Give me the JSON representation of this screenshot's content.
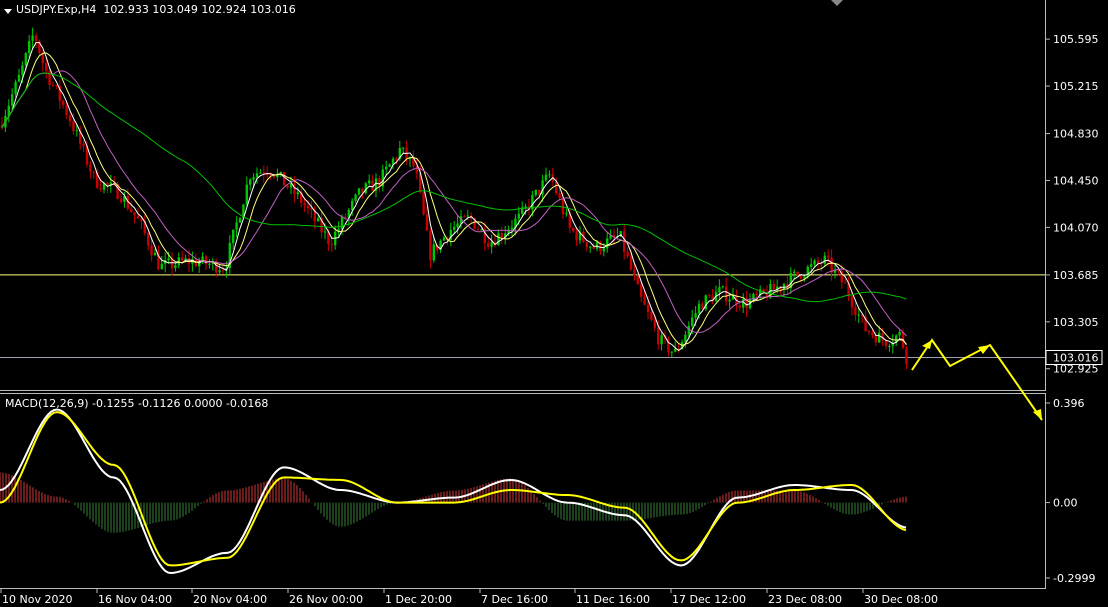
{
  "header": {
    "symbol": "USDJPY.Exp,H4",
    "ohlc": "102.933 103.049 102.924 103.016"
  },
  "macd_header": {
    "label": "MACD(12,26,9)",
    "values": "-0.1255 -0.1126 0.0000 -0.0168"
  },
  "price_axis": {
    "ticks": [
      "105.595",
      "105.215",
      "104.830",
      "104.450",
      "104.070",
      "103.685",
      "103.305",
      "102.925"
    ],
    "current_price_label": "103.016"
  },
  "macd_axis": {
    "ticks": [
      "0.396",
      "0.00",
      "-0.2999"
    ]
  },
  "time_axis": {
    "labels": [
      "10 Nov 2020",
      "16 Nov 04:00",
      "20 Nov 04:00",
      "26 Nov 00:00",
      "1 Dec 20:00",
      "7 Dec 16:00",
      "11 Dec 16:00",
      "17 Dec 12:00",
      "23 Dec 08:00",
      "30 Dec 08:00"
    ]
  },
  "colors": {
    "background": "#000000",
    "bull": "#00c800",
    "bear": "#c80000",
    "ma_fast": "#ffffff",
    "ma_mid": "#ffff80",
    "ma_slow": "#c060c0",
    "ma_long": "#00c000",
    "macd_line": "#ffffff",
    "signal_line": "#ffff00",
    "hist_pos": "#b03030",
    "hist_neg": "#2f6b2f",
    "hline": "#ffff80",
    "arrow": "#ffff00"
  },
  "chart_data": [
    {
      "type": "line",
      "title": "USDJPY.Exp,H4",
      "ylim": [
        102.85,
        105.75
      ],
      "x": [
        "10 Nov 2020",
        "16 Nov 04:00",
        "20 Nov 04:00",
        "26 Nov 00:00",
        "1 Dec 20:00",
        "7 Dec 16:00",
        "11 Dec 16:00",
        "17 Dec 12:00",
        "23 Dec 08:00",
        "30 Dec 08:00"
      ],
      "series": [
        {
          "values": [
            105.0,
            104.3,
            103.85,
            104.4,
            104.6,
            104.2,
            104.1,
            103.3,
            103.75,
            103.1
          ]
        }
      ],
      "horizontal_lines": [
        103.685,
        103.016
      ],
      "grid": false
    },
    {
      "type": "bar",
      "title": "MACD(12,26,9)",
      "ylim": [
        -0.2999,
        0.396
      ],
      "series": [
        {
          "name": "MACD",
          "values": [
            0.05,
            0.37,
            0.1,
            -0.28,
            -0.2,
            0.14,
            0.05,
            0.0,
            0.02,
            0.09,
            0.0,
            -0.05,
            -0.25,
            0.02,
            0.07,
            0.05,
            -0.1
          ]
        },
        {
          "name": "Signal",
          "values": [
            0.0,
            0.36,
            0.15,
            -0.25,
            -0.22,
            0.1,
            0.09,
            0.0,
            0.0,
            0.05,
            0.03,
            -0.02,
            -0.23,
            0.0,
            0.05,
            0.07,
            -0.11
          ]
        }
      ]
    }
  ]
}
